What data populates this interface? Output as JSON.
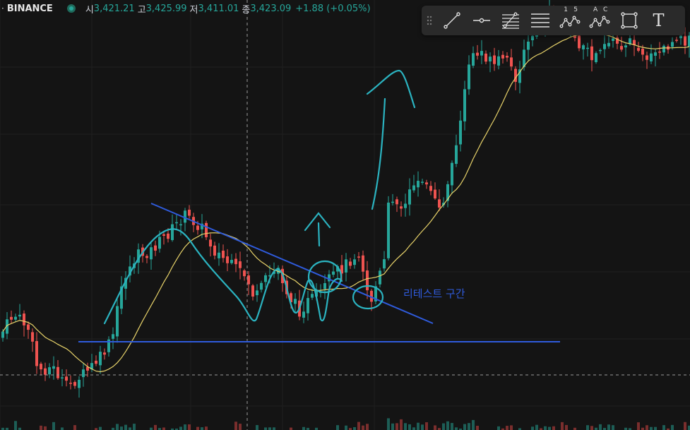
{
  "header": {
    "separator": "·",
    "exchange": "BINANCE",
    "open_label": "시",
    "open_value": "3,421.21",
    "high_label": "고",
    "high_value": "3,425.99",
    "low_label": "저",
    "low_value": "3,411.01",
    "close_label": "종",
    "close_value": "3,423.09",
    "change": "+1.88 (+0.05%)"
  },
  "toolbar": {
    "tools": [
      "trend-line-icon",
      "horizontal-ray-icon",
      "fib-retracement-icon",
      "parallel-lines-icon",
      "xabcd-pattern-icon",
      "abc-pattern-icon",
      "rectangle-icon",
      "text-icon"
    ],
    "pattern1_label_a": "1",
    "pattern1_label_b": "5",
    "pattern2_label_a": "A",
    "pattern2_label_b": "C",
    "text_tool_glyph": "T"
  },
  "annotation": {
    "retest_label": "리테스트 구간"
  },
  "colors": {
    "background": "#141414",
    "up_candle": "#26a69a",
    "down_candle": "#ef5350",
    "moving_average": "#e8d36a",
    "trend_lines": "#2f5bdc",
    "hand_drawing": "#2bb3c0"
  }
}
